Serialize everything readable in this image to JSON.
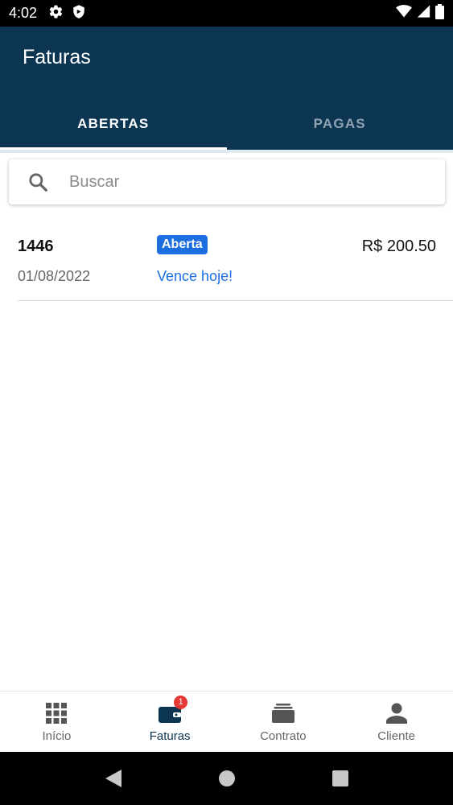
{
  "status_bar": {
    "time": "4:02"
  },
  "header": {
    "title": "Faturas",
    "tabs": [
      {
        "label": "ABERTAS",
        "active": true
      },
      {
        "label": "PAGAS",
        "active": false
      }
    ]
  },
  "search": {
    "placeholder": "Buscar"
  },
  "invoices": [
    {
      "number": "1446",
      "date": "01/08/2022",
      "badge": "Aberta",
      "due_text": "Vence hoje!",
      "amount": "R$ 200.50"
    }
  ],
  "bottom_nav": {
    "items": [
      {
        "label": "Início",
        "icon": "grid-icon"
      },
      {
        "label": "Faturas",
        "icon": "wallet-icon",
        "badge": "1"
      },
      {
        "label": "Contrato",
        "icon": "folder-stack-icon"
      },
      {
        "label": "Cliente",
        "icon": "person-icon"
      }
    ]
  },
  "colors": {
    "header_bg": "#0c3552",
    "accent": "#1d6fe0",
    "badge_red": "#e53935"
  }
}
